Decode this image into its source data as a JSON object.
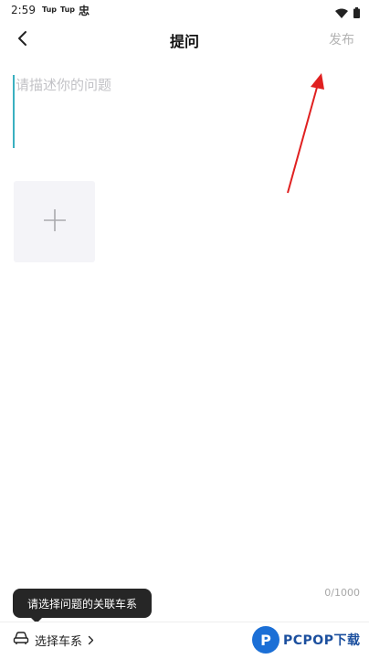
{
  "status_bar": {
    "time": "2:59",
    "notif_1": "Tup",
    "notif_2": "Tup",
    "notif_3": "忠",
    "icons": [
      "wifi-icon",
      "battery-icon"
    ]
  },
  "nav": {
    "back_icon": "chevron-left-icon",
    "title": "提问",
    "publish_label": "发布"
  },
  "editor": {
    "placeholder": "请描述你的问题",
    "value": "",
    "add_image_icon": "plus-icon",
    "counter": "0/1000"
  },
  "tooltip": {
    "text": "请选择问题的关联车系"
  },
  "bottom": {
    "car_icon": "car-icon",
    "select_series_label": "选择车系",
    "chevron_icon": "chevron-right-icon"
  },
  "watermark": {
    "logo_letter": "P",
    "text": "PCPOP下载"
  },
  "colors": {
    "publish_disabled": "#b3b3b3",
    "placeholder": "#c2c2c6",
    "cursor": "#3ab0c0",
    "add_image_bg": "#f4f4f8",
    "tooltip_bg": "#262626",
    "annotation_arrow": "#e02020",
    "watermark_blue": "#1b6fd6"
  }
}
